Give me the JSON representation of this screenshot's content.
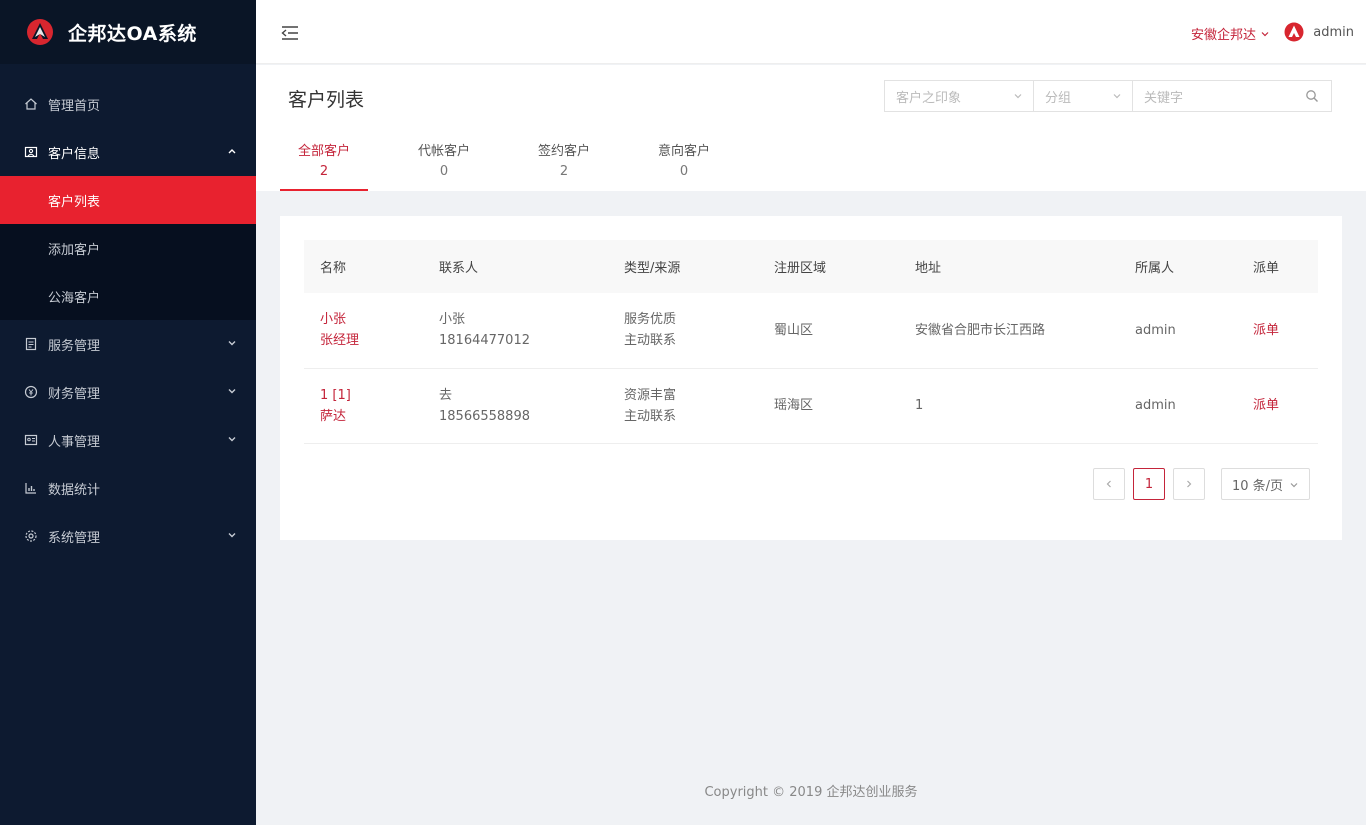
{
  "app": {
    "title": "企邦达OA系统"
  },
  "sidebar": {
    "items": [
      {
        "label": "管理首页",
        "icon": "home-icon"
      },
      {
        "label": "客户信息",
        "icon": "customer-icon",
        "open": true,
        "children": [
          {
            "label": "客户列表",
            "active": true
          },
          {
            "label": "添加客户"
          },
          {
            "label": "公海客户"
          }
        ]
      },
      {
        "label": "服务管理",
        "icon": "service-icon"
      },
      {
        "label": "财务管理",
        "icon": "finance-icon"
      },
      {
        "label": "人事管理",
        "icon": "hr-icon"
      },
      {
        "label": "数据统计",
        "icon": "chart-icon"
      },
      {
        "label": "系统管理",
        "icon": "settings-icon"
      }
    ]
  },
  "header": {
    "company": "安徽企邦达",
    "user": "admin"
  },
  "page": {
    "title": "客户列表"
  },
  "filters": {
    "impression_placeholder": "客户之印象",
    "group_placeholder": "分组",
    "keyword_placeholder": "关键字"
  },
  "tabs": [
    {
      "label": "全部客户",
      "count": "2",
      "active": true
    },
    {
      "label": "代帐客户",
      "count": "0"
    },
    {
      "label": "签约客户",
      "count": "2"
    },
    {
      "label": "意向客户",
      "count": "0"
    }
  ],
  "table": {
    "headers": [
      "名称",
      "联系人",
      "类型/来源",
      "注册区域",
      "地址",
      "所属人",
      "派单"
    ],
    "rows": [
      {
        "name1": "小张",
        "name2": "张经理",
        "contact": "小张",
        "phone": "18164477012",
        "type": "服务优质",
        "source": "主动联系",
        "region": "蜀山区",
        "address": "安徽省合肥市长江西路",
        "owner": "admin",
        "action": "派单"
      },
      {
        "name1": "1 [1]",
        "name2": "萨达",
        "contact": "去",
        "phone": "18566558898",
        "type": "资源丰富",
        "source": "主动联系",
        "region": "瑶海区",
        "address": "1",
        "owner": "admin",
        "action": "派单"
      }
    ]
  },
  "pagination": {
    "current": "1",
    "page_size": "10 条/页"
  },
  "footer": {
    "text": "Copyright © 2019 企邦达创业服务"
  },
  "colors": {
    "sidebar_bg": "#0d1a30",
    "accent": "#e8222f",
    "link": "#c4243a"
  }
}
